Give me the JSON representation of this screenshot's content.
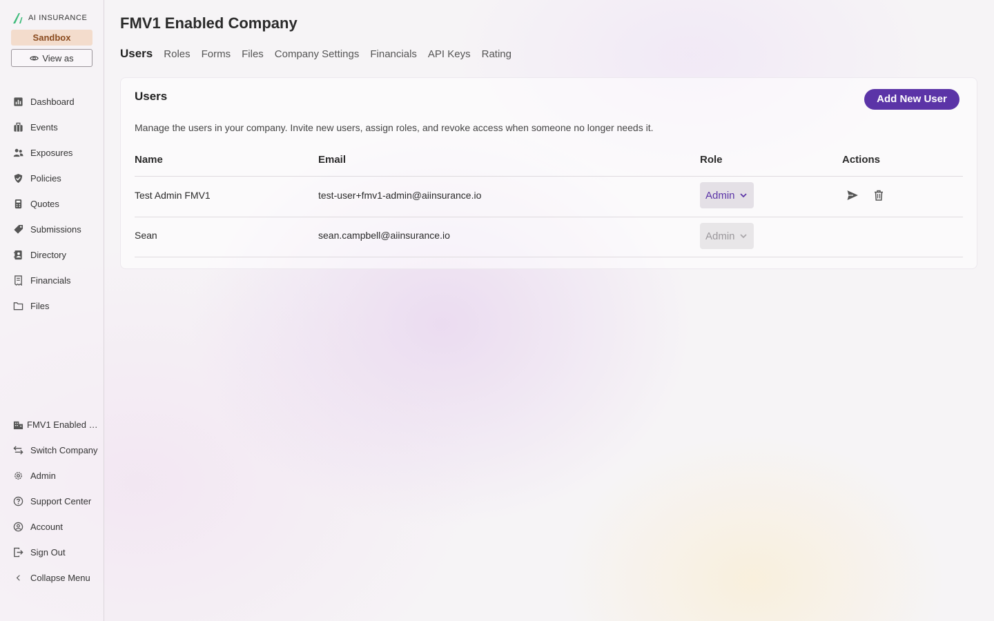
{
  "brand": {
    "logo_text": "AI INSURANCE",
    "env_badge": "Sandbox",
    "view_as_label": "View as"
  },
  "nav": {
    "items": [
      {
        "label": "Dashboard",
        "icon": "bar-chart-icon"
      },
      {
        "label": "Events",
        "icon": "briefcase-icon"
      },
      {
        "label": "Exposures",
        "icon": "people-icon"
      },
      {
        "label": "Policies",
        "icon": "shield-check-icon"
      },
      {
        "label": "Quotes",
        "icon": "calculator-icon"
      },
      {
        "label": "Submissions",
        "icon": "tag-icon"
      },
      {
        "label": "Directory",
        "icon": "contact-book-icon"
      },
      {
        "label": "Financials",
        "icon": "receipt-icon"
      },
      {
        "label": "Files",
        "icon": "folder-icon"
      }
    ],
    "bottom": [
      {
        "label": "FMV1 Enabled …",
        "icon": "building-icon"
      },
      {
        "label": "Switch Company",
        "icon": "switch-arrows-icon"
      },
      {
        "label": "Admin",
        "icon": "gear-icon"
      },
      {
        "label": "Support Center",
        "icon": "help-circle-icon"
      },
      {
        "label": "Account",
        "icon": "user-circle-icon"
      },
      {
        "label": "Sign Out",
        "icon": "sign-out-icon"
      },
      {
        "label": "Collapse Menu",
        "icon": "chevron-left-icon"
      }
    ]
  },
  "page": {
    "title": "FMV1 Enabled Company",
    "tabs": [
      "Users",
      "Roles",
      "Forms",
      "Files",
      "Company Settings",
      "Financials",
      "API Keys",
      "Rating"
    ],
    "active_tab": "Users"
  },
  "users_card": {
    "title": "Users",
    "add_button": "Add New User",
    "description": "Manage the users in your company. Invite new users, assign roles, and revoke access when someone no longer needs it.",
    "columns": [
      "Name",
      "Email",
      "Role",
      "Actions"
    ],
    "rows": [
      {
        "name": "Test Admin FMV1",
        "email": "test-user+fmv1-admin@aiinsurance.io",
        "role": "Admin",
        "role_enabled": true,
        "actions": [
          "send-icon",
          "trash-icon"
        ]
      },
      {
        "name": "Sean",
        "email": "sean.campbell@aiinsurance.io",
        "role": "Admin",
        "role_enabled": false,
        "actions": []
      }
    ]
  },
  "colors": {
    "accent": "#5b34a7",
    "badge_bg": "#f3dccc",
    "badge_text": "#8a4a1e"
  }
}
